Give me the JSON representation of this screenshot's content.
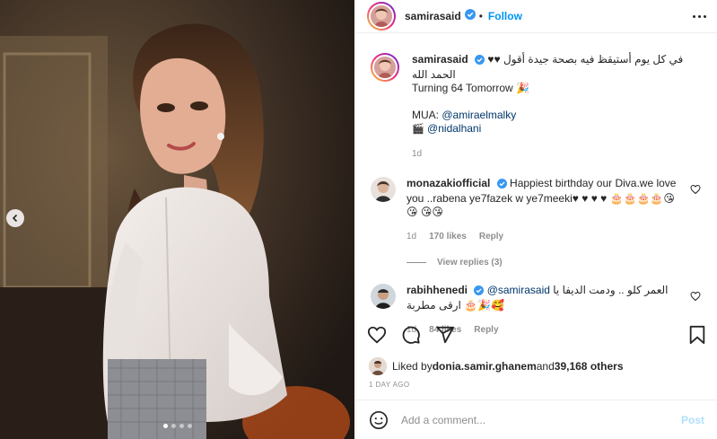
{
  "header": {
    "username": "samirasaid",
    "separator": "•",
    "follow_label": "Follow"
  },
  "caption": {
    "username": "samirasaid",
    "line1": "♥♥ في كل يوم أستيقظ فيه بصحة جيدة أقول الحمد الله",
    "line2": "Turning 64 Tomorrow 🎉",
    "mua_label": "MUA: ",
    "mua_handle": "@amiraelmalky",
    "camera_icon": "🎬",
    "photo_handle": "@nidalhani",
    "time": "1d"
  },
  "comments": [
    {
      "username": "monazakiofficial",
      "text": "Happiest birthday our Diva.we love you ..rabena ye7fazek w ye7meeki♥ ♥ ♥ ♥ 🎂🎂🎂🎂😘😘 😘😘",
      "time": "1d",
      "likes": "170 likes",
      "reply": "Reply",
      "view_replies": "View replies (3)"
    },
    {
      "username": "rabihhenedi",
      "mention": "@samirasaid",
      "text": "العمر كلو .. ودمت الديفا يا ارقى مطربة 🎂🎉🥰",
      "time": "1d",
      "likes": "84 likes",
      "reply": "Reply"
    }
  ],
  "likes": {
    "prefix": "Liked by ",
    "user": "donia.samir.ghanem",
    "and": " and ",
    "others": "39,168 others"
  },
  "date": "1 DAY AGO",
  "add_comment": {
    "placeholder": "Add a comment...",
    "post_label": "Post"
  },
  "carousel": {
    "total": 4,
    "active_index": 0
  },
  "colors": {
    "accent": "#0095f6",
    "verified": "#3897f0",
    "link": "#00376b",
    "muted": "#8e8e8e"
  }
}
